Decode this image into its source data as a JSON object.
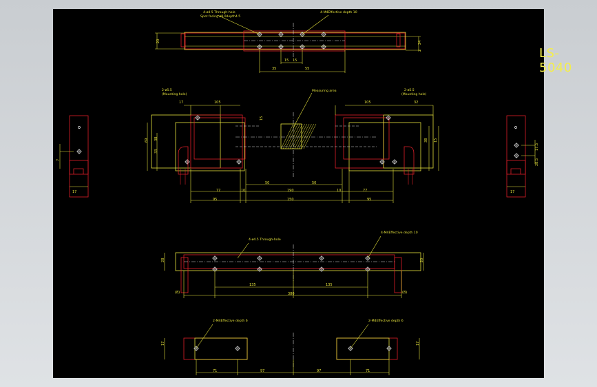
{
  "title": "LS-5040",
  "colors": {
    "background": "#000000",
    "part_outline": "#e0202a",
    "dimension": "#e6e33c",
    "centerline": "#d8d8d8",
    "hole": "#f0f0f0",
    "hatch": "#e6e33c",
    "frame": "#d4d8dc"
  },
  "top_view": {
    "note_left_1": "4-ø4.5 Through-hole",
    "note_left_2": "Spot facing ø8.0depth4.5",
    "note_right": "4-M4Effective depth 10",
    "dims": [
      "35",
      "15",
      "15",
      "55",
      "20",
      "24",
      "2"
    ]
  },
  "front_view": {
    "note_left_1": "2-ø5.5",
    "note_left_2": "(Mounting hole)",
    "note_right_1": "2-ø5.5",
    "note_right_2": "(Mounting hole)",
    "note_center": "Measuring area",
    "dims_top": [
      "17",
      "105",
      "105",
      "32"
    ],
    "dims_side_left": [
      "69",
      "38",
      "33"
    ],
    "dims_side_right": [
      "15",
      "38"
    ],
    "dims_mid": [
      "50",
      "30",
      "50"
    ],
    "dims_row1": [
      "77",
      "10",
      "190",
      "10",
      "77"
    ],
    "dims_row2": [
      "95",
      "150",
      "95"
    ]
  },
  "left_end_view": {
    "dims": [
      "7",
      "17"
    ]
  },
  "right_end_view": {
    "dims": [
      "17.5",
      "28.5",
      "17"
    ]
  },
  "bottom_plan_view": {
    "note_left": "4-ø4.5 Through-hole",
    "note_right": "4-M4Effective depth 10",
    "dims": [
      "28",
      "20",
      "135",
      "135",
      "380",
      "(8)",
      "(8)"
    ]
  },
  "bottom_blocks_view": {
    "note_left": "2-M4Effective depth 6",
    "note_right": "2-M4Effective depth 6",
    "dims": [
      "17",
      "17",
      "71",
      "97",
      "97",
      "71"
    ]
  }
}
